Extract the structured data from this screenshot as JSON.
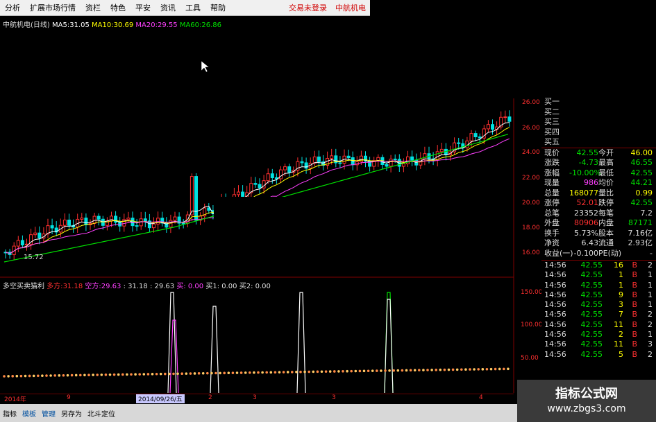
{
  "menu": {
    "items": [
      "分析",
      "扩展市场行情",
      "资栏",
      "特色",
      "平安",
      "资讯",
      "工具",
      "帮助"
    ],
    "status_login": "交易未登录",
    "stock_name": "中航机电"
  },
  "ma_line": {
    "name": "中航机电(日线)",
    "ma5_label": "MA5:",
    "ma5": "31.05",
    "ma10_label": "MA10:",
    "ma10": "30.69",
    "ma20_label": "MA20:",
    "ma20": "29.55",
    "ma60_label": "MA60:",
    "ma60": "26.86"
  },
  "indicator_line": {
    "name": "多空买卖猫利",
    "duo_label": "多方:",
    "duo": "31.18",
    "kong_label": "空方:",
    "kong": "29.63",
    "extra": ": 31.18 : 29.63",
    "buy_label": "买: 0.00",
    "buy1_label": "买1: 0.00",
    "buy2_label": "买2: 0.00"
  },
  "price_axis": [
    "26.00",
    "26.00",
    "24.00",
    "22.00",
    "20.00",
    "18.00",
    "16.00"
  ],
  "ind_axis": [
    "150.00",
    "100.00",
    "50.00"
  ],
  "low_marker": "15.72",
  "order_book": [
    "买一",
    "买二",
    "买三",
    "买四",
    "买五"
  ],
  "quote": [
    {
      "l1": "现价",
      "v1": "42.55",
      "l2": "今开",
      "v2": "46.00",
      "c1": "#00e000",
      "c2": "#ffff00"
    },
    {
      "l1": "涨跌",
      "v1": "-4.73",
      "l2": "最高",
      "v2": "46.55",
      "c1": "#00e000",
      "c2": "#00e000"
    },
    {
      "l1": "涨幅",
      "v1": "-10.00%",
      "l2": "最低",
      "v2": "42.55",
      "c1": "#00e000",
      "c2": "#00e000"
    },
    {
      "l1": "现量",
      "v1": "986",
      "l2": "均价",
      "v2": "44.21",
      "c1": "#ff40ff",
      "c2": "#00e000"
    },
    {
      "l1": "总量",
      "v1": "168077",
      "l2": "量比",
      "v2": "0.99",
      "c1": "#ffff00",
      "c2": "#ffff00"
    },
    {
      "l1": "涨停",
      "v1": "52.01",
      "l2": "跌停",
      "v2": "42.55",
      "c1": "#ff3030",
      "c2": "#00e000"
    },
    {
      "l1": "总笔",
      "v1": "23352",
      "l2": "每笔",
      "v2": "7.2",
      "c1": "#dddddd",
      "c2": "#dddddd"
    },
    {
      "l1": "外盘",
      "v1": "80906",
      "l2": "内盘",
      "v2": "87171",
      "c1": "#ff3030",
      "c2": "#00e000"
    },
    {
      "l1": "换手",
      "v1": "5.73%",
      "l2": "股本",
      "v2": "7.16亿",
      "c1": "#dddddd",
      "c2": "#dddddd"
    },
    {
      "l1": "净资",
      "v1": "6.43",
      "l2": "流通",
      "v2": "2.93亿",
      "c1": "#dddddd",
      "c2": "#dddddd"
    },
    {
      "l1": "收益(一)",
      "v1": "-0.100",
      "l2": "PE(动)",
      "v2": "-",
      "c1": "#dddddd",
      "c2": "#dddddd"
    }
  ],
  "trades": [
    {
      "t": "14:56",
      "p": "42.55",
      "v": "16",
      "d": "B",
      "n": "2"
    },
    {
      "t": "14:56",
      "p": "42.55",
      "v": "1",
      "d": "B",
      "n": "1"
    },
    {
      "t": "14:56",
      "p": "42.55",
      "v": "1",
      "d": "B",
      "n": "1"
    },
    {
      "t": "14:56",
      "p": "42.55",
      "v": "9",
      "d": "B",
      "n": "1"
    },
    {
      "t": "14:56",
      "p": "42.55",
      "v": "3",
      "d": "B",
      "n": "1"
    },
    {
      "t": "14:56",
      "p": "42.55",
      "v": "7",
      "d": "B",
      "n": "2"
    },
    {
      "t": "14:56",
      "p": "42.55",
      "v": "11",
      "d": "B",
      "n": "2"
    },
    {
      "t": "14:56",
      "p": "42.55",
      "v": "2",
      "d": "B",
      "n": "1"
    },
    {
      "t": "14:56",
      "p": "42.55",
      "v": "11",
      "d": "B",
      "n": "3"
    },
    {
      "t": "14:56",
      "p": "42.55",
      "v": "5",
      "d": "B",
      "n": "2"
    }
  ],
  "date_bar": {
    "year": "2014年",
    "d1": "9",
    "selected": "2014/09/26/五",
    "d2": "2",
    "d3": "3",
    "d4": "3",
    "d5": "4"
  },
  "bottom": [
    "指标",
    "模板",
    "管理",
    "另存为",
    "北斗定位"
  ],
  "watermark": {
    "line1": "指标公式网",
    "line2": "www.zbgs3.com"
  },
  "colors": {
    "up": "#ff3030",
    "down": "#00e0e0",
    "ma5": "#ffffff",
    "ma10": "#ffff00",
    "ma20": "#ff40ff",
    "ma60": "#00e000"
  }
}
